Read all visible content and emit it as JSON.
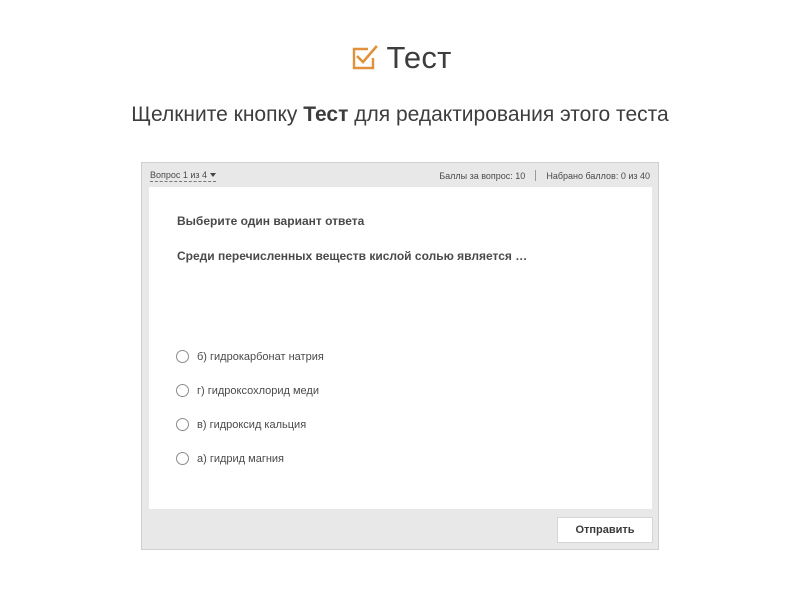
{
  "header": {
    "title": "Тест",
    "title_icon": "checkbox-check-icon",
    "accent_color": "#e0913a"
  },
  "subtitle": {
    "before": "Щелкните кнопку ",
    "bold": "Тест",
    "after": " для редактирования этого теста"
  },
  "quiz": {
    "question_counter": "Вопрос 1 из 4",
    "points_per_question": "Баллы за вопрос: 10",
    "points_scored": "Набрано баллов: 0 из 40",
    "instruction": "Выберите один вариант ответа",
    "question": "Среди перечисленных веществ кислой солью является …",
    "options": [
      {
        "label": "б) гидрокарбонат натрия"
      },
      {
        "label": "г) гидроксохлорид меди"
      },
      {
        "label": "в) гидроксид кальция"
      },
      {
        "label": "а) гидрид магния"
      }
    ],
    "submit_label": "Отправить"
  }
}
